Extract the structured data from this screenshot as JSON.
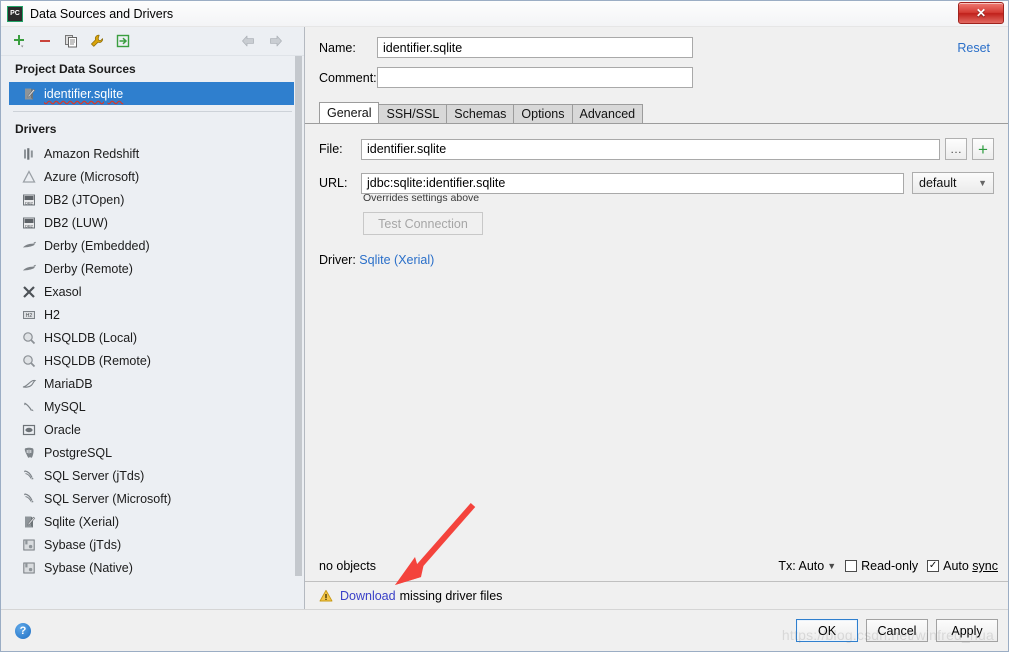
{
  "window": {
    "title": "Data Sources and Drivers",
    "app_icon": "pycharm-icon",
    "app_icon_text": "PC",
    "close_label": "✕"
  },
  "sidebar": {
    "toolbar": [
      {
        "name": "add-button",
        "glyph": "+"
      },
      {
        "name": "remove-button",
        "glyph": "−"
      },
      {
        "name": "copy-button",
        "glyph": "copy"
      },
      {
        "name": "driver-properties-button",
        "glyph": "wrench"
      },
      {
        "name": "import-button",
        "glyph": "import"
      },
      {
        "name": "back-button",
        "glyph": "←"
      },
      {
        "name": "forward-button",
        "glyph": "→"
      }
    ],
    "project_group_label": "Project Data Sources",
    "data_sources": [
      {
        "label": "identifier.sqlite",
        "icon": "sqlite-icon",
        "selected": true
      }
    ],
    "drivers_group_label": "Drivers",
    "drivers": [
      {
        "label": "Amazon Redshift",
        "icon": "redshift-icon"
      },
      {
        "label": "Azure (Microsoft)",
        "icon": "azure-icon"
      },
      {
        "label": "DB2 (JTOpen)",
        "icon": "db2-icon"
      },
      {
        "label": "DB2 (LUW)",
        "icon": "db2-icon"
      },
      {
        "label": "Derby (Embedded)",
        "icon": "derby-icon"
      },
      {
        "label": "Derby (Remote)",
        "icon": "derby-icon"
      },
      {
        "label": "Exasol",
        "icon": "exasol-icon"
      },
      {
        "label": "H2",
        "icon": "h2-icon"
      },
      {
        "label": "HSQLDB (Local)",
        "icon": "hsqldb-icon"
      },
      {
        "label": "HSQLDB (Remote)",
        "icon": "hsqldb-icon"
      },
      {
        "label": "MariaDB",
        "icon": "mariadb-icon"
      },
      {
        "label": "MySQL",
        "icon": "mysql-icon"
      },
      {
        "label": "Oracle",
        "icon": "oracle-icon"
      },
      {
        "label": "PostgreSQL",
        "icon": "postgresql-icon"
      },
      {
        "label": "SQL Server (jTds)",
        "icon": "sqlserver-icon"
      },
      {
        "label": "SQL Server (Microsoft)",
        "icon": "sqlserver-icon"
      },
      {
        "label": "Sqlite (Xerial)",
        "icon": "sqlite-icon"
      },
      {
        "label": "Sybase (jTds)",
        "icon": "sybase-icon"
      },
      {
        "label": "Sybase (Native)",
        "icon": "sybase-icon"
      }
    ]
  },
  "form": {
    "name_label": "Name:",
    "name_value": "identifier.sqlite",
    "comment_label": "Comment:",
    "comment_value": "",
    "reset_label": "Reset"
  },
  "tabs": [
    {
      "label": "General",
      "active": true
    },
    {
      "label": "SSH/SSL",
      "active": false
    },
    {
      "label": "Schemas",
      "active": false
    },
    {
      "label": "Options",
      "active": false
    },
    {
      "label": "Advanced",
      "active": false
    }
  ],
  "general": {
    "file_label": "File:",
    "file_value": "identifier.sqlite",
    "browse_label": "…",
    "add_label": "+",
    "url_label": "URL:",
    "url_value": "jdbc:sqlite:identifier.sqlite",
    "url_hint": "Overrides settings above",
    "driver_select_value": "default",
    "test_connection_label": "Test Connection",
    "driver_label": "Driver:",
    "driver_value": "Sqlite (Xerial)"
  },
  "status": {
    "objects_text": "no objects",
    "tx_label": "Tx: Auto",
    "read_only_label": "Read-only",
    "read_only_checked": false,
    "auto_sync_label": "Auto sync",
    "auto_sync_checked": true,
    "check_glyph": "✓"
  },
  "warning": {
    "icon": "warning-triangle-icon",
    "link_label": "Download",
    "rest_label": "missing driver files"
  },
  "footer": {
    "help_label": "?",
    "ok_label": "OK",
    "cancel_label": "Cancel",
    "apply_label": "Apply"
  },
  "watermark": "https://blog.csdn.net/winfred_hua",
  "colors": {
    "selection": "#2f7fce",
    "link": "#2a6fc9",
    "download_link": "#3a40c8",
    "accent_green": "#2d9c3f",
    "warning": "#e8a317",
    "annotation_arrow": "#f4433c"
  }
}
